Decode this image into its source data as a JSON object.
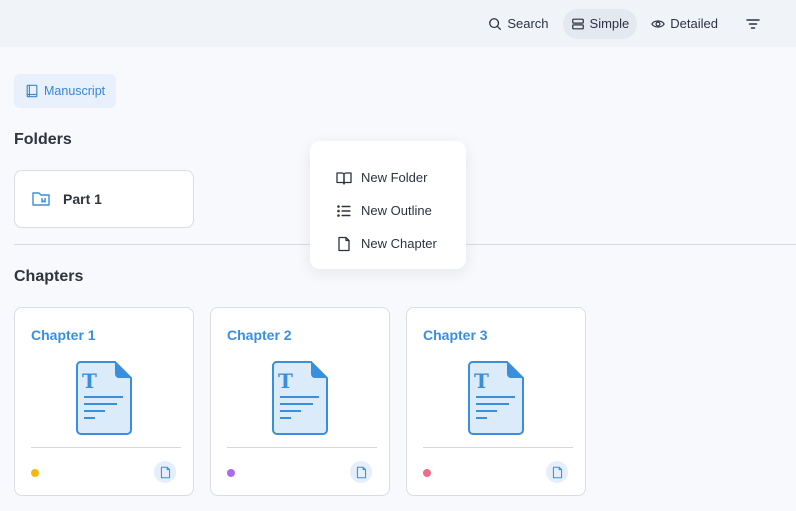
{
  "topbar": {
    "search_label": "Search",
    "simple_label": "Simple",
    "detailed_label": "Detailed"
  },
  "breadcrumb": {
    "label": "Manuscript"
  },
  "folders": {
    "title": "Folders",
    "items": [
      {
        "label": "Part 1"
      }
    ]
  },
  "chapters": {
    "title": "Chapters",
    "items": [
      {
        "title": "Chapter 1",
        "dot_color": "#f5b90a"
      },
      {
        "title": "Chapter 2",
        "dot_color": "#a96cf0"
      },
      {
        "title": "Chapter 3",
        "dot_color": "#f06a8a"
      }
    ]
  },
  "context_menu": {
    "items": [
      {
        "label": "New Folder",
        "icon": "book-open-icon"
      },
      {
        "label": "New Outline",
        "icon": "list-icon"
      },
      {
        "label": "New Chapter",
        "icon": "file-icon"
      }
    ]
  },
  "colors": {
    "accent": "#3a8fdc",
    "crumb_bg": "#e7f0fb"
  }
}
